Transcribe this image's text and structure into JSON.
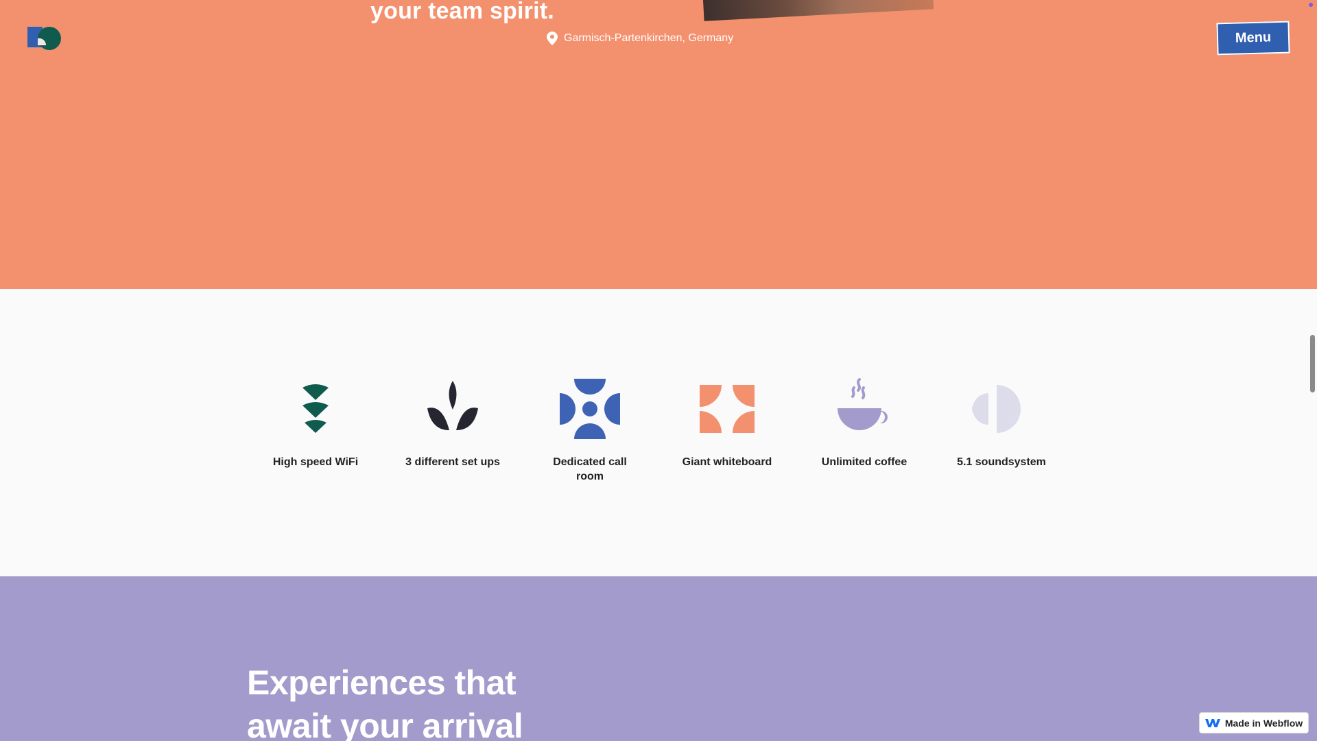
{
  "hero": {
    "tagline": "your team spirit.",
    "location": "Garmisch-Partenkirchen, Germany",
    "location_icon": "map-pin-icon",
    "menu_label": "Menu"
  },
  "amenities": [
    {
      "label": "High speed WiFi",
      "icon": "wifi-icon",
      "color": "#0f5c4f"
    },
    {
      "label": "3 different set ups",
      "icon": "leaves-icon",
      "color": "#262631"
    },
    {
      "label": "Dedicated call room",
      "icon": "call-room-icon",
      "color": "#3f63b4"
    },
    {
      "label": "Giant whiteboard",
      "icon": "whiteboard-icon",
      "color": "#f3916f"
    },
    {
      "label": "Unlimited coffee",
      "icon": "coffee-cup-icon",
      "color": "#a39bcc"
    },
    {
      "label": "5.1 soundsystem",
      "icon": "speaker-icon",
      "color": "#dcdcea"
    }
  ],
  "experiences": {
    "heading": "Experiences that await your arrival"
  },
  "badge": {
    "label": "Made in Webflow",
    "icon": "webflow-logo-icon"
  },
  "colors": {
    "hero_bg": "#f3916f",
    "amenities_bg": "#fbfafb",
    "experiences_bg": "#a39bcc",
    "menu_button": "#2f5fae"
  }
}
